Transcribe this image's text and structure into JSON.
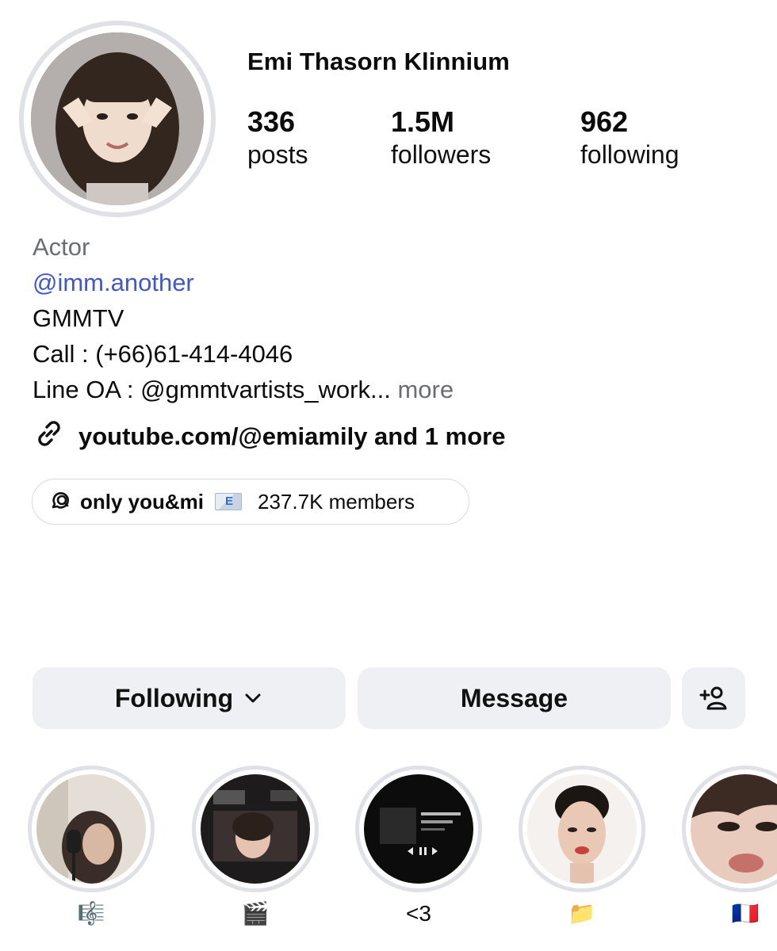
{
  "profile": {
    "name": "Emi Thasorn Klinnium",
    "stats": {
      "posts": {
        "value": "336",
        "label": "posts"
      },
      "followers": {
        "value": "1.5M",
        "label": "followers"
      },
      "following": {
        "value": "962",
        "label": "following"
      }
    }
  },
  "bio": {
    "category": "Actor",
    "mention": "@imm.another",
    "line1": "GMMTV",
    "line2": "Call : (+66)61-414-4046",
    "line3": "Line OA : @gmmtvartists_work...",
    "more": "more",
    "link": "youtube.com/@emiamily and 1 more"
  },
  "channel": {
    "name": "only you&mi",
    "members": "237.7K members"
  },
  "buttons": {
    "following": "Following",
    "message": "Message"
  },
  "highlights": [
    {
      "label": "🎼"
    },
    {
      "label": "🎬"
    },
    {
      "label": "<3"
    },
    {
      "label": "📁"
    },
    {
      "label": "🇫🇷"
    }
  ],
  "icons": {
    "link": "link-icon",
    "channel": "broadcast-channel-icon",
    "chevron": "chevron-down-icon",
    "add_user": "add-user-icon"
  },
  "colors": {
    "mention": "#4357c8",
    "button_bg": "#eef0f3",
    "ring": "#dfe1e7",
    "muted": "#6b6d72"
  }
}
